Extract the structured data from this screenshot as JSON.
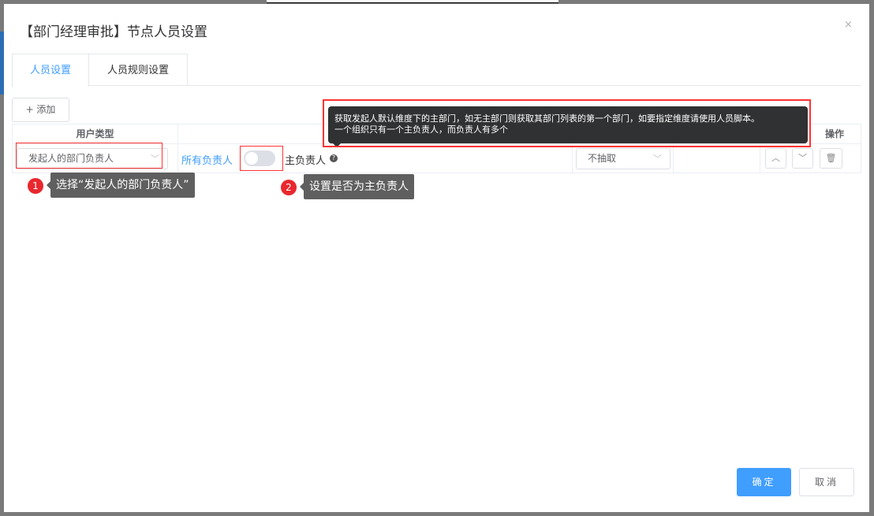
{
  "dialog": {
    "title": "【部门经理审批】节点人员设置",
    "close_icon": "×"
  },
  "tabs": [
    {
      "label": "人员设置",
      "active": true
    },
    {
      "label": "人员规则设置",
      "active": false
    }
  ],
  "toolbar": {
    "add_label": "+ 添加"
  },
  "table": {
    "headers": [
      "用户类型",
      "",
      "",
      "",
      "操作"
    ],
    "row": {
      "user_type": "发起人的部门负责人",
      "all_heads_label": "所有负责人",
      "main_head_toggle": false,
      "main_head_label": "主负责人",
      "extract": "不抽取"
    }
  },
  "tooltip": {
    "line1": "获取发起人默认维度下的主部门，如无主部门则获取其部门列表的第一个部门，如要指定维度请使用人员脚本。",
    "line2": "一个组织只有一个主负责人，而负责人有多个"
  },
  "annotations": [
    {
      "num": "1",
      "text": "选择“发起人的部门负责人”"
    },
    {
      "num": "2",
      "text": "设置是否为主负责人"
    }
  ],
  "footer": {
    "ok": "确定",
    "cancel": "取消"
  }
}
